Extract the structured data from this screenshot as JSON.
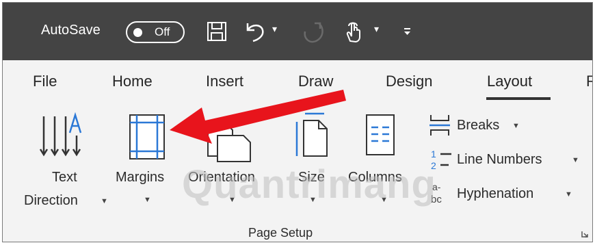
{
  "title_bar": {
    "autosave_label": "AutoSave",
    "autosave_state": "Off",
    "qat_icons": [
      "save-icon",
      "undo-icon",
      "redo-icon",
      "touch-mode-icon",
      "customize-qat-icon"
    ]
  },
  "tabs": [
    {
      "label": "File"
    },
    {
      "label": "Home"
    },
    {
      "label": "Insert"
    },
    {
      "label": "Draw"
    },
    {
      "label": "Design"
    },
    {
      "label": "Layout",
      "active": true
    },
    {
      "label": "R"
    }
  ],
  "ribbon": {
    "text_direction": {
      "line1": "Text",
      "line2": "Direction"
    },
    "margins": "Margins",
    "orientation": "Orientation",
    "size": "Size",
    "columns": "Columns",
    "breaks": "Breaks",
    "line_numbers": "Line Numbers",
    "hyphenation": "Hyphenation",
    "group_label": "Page Setup"
  },
  "annotation": {
    "arrow_color": "#e8141c",
    "points_to": "margins-button"
  },
  "watermark": "Quantrimang",
  "colors": {
    "title_bar": "#444444",
    "ribbon": "#f3f3f3",
    "accent_blue": "#2b78d6"
  }
}
